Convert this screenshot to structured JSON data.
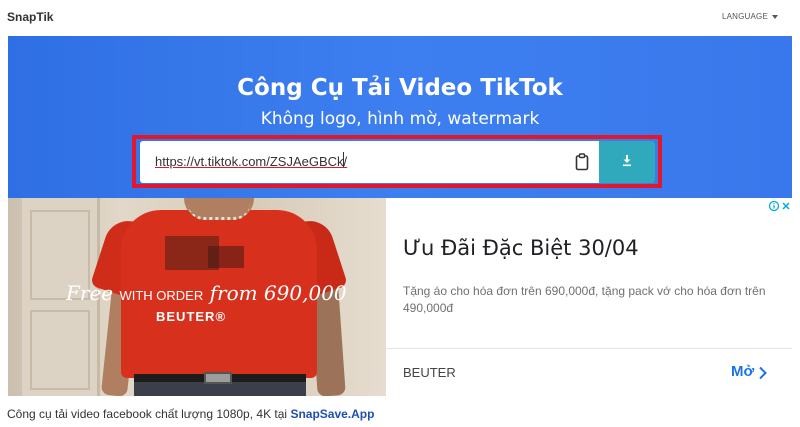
{
  "header": {
    "brand": "SnapTik",
    "language_label": "LANGUAGE"
  },
  "hero": {
    "title": "Công Cụ Tải Video TikTok",
    "subtitle": "Không logo, hình mờ, watermark",
    "url_value": "https://vt.tiktok.com/ZSJAeGBCk/",
    "paste_icon": "clipboard-icon",
    "download_icon": "download-icon"
  },
  "ad": {
    "promo_free": "Free",
    "promo_with_order": "WITH ORDER",
    "promo_from": "from 690,000",
    "promo_brand": "BEUTER®",
    "title": "Ưu Đãi Đặc Biệt 30/04",
    "description": "Tặng áo cho hóa đơn trên 690,000đ, tặng pack vớ cho hóa đơn trên 490,000đ",
    "advertiser": "BEUTER",
    "cta": "Mở",
    "choices_icon": "adchoices-icon"
  },
  "footer": {
    "text": "Công cụ tải video facebook chất lượng 1080p, 4K tại",
    "link": "SnapSave.App"
  },
  "colors": {
    "hero_bg": "#3978ec",
    "download_btn": "#2fa9bb",
    "highlight": "#e3172b",
    "ad_cta": "#1a73e8"
  }
}
